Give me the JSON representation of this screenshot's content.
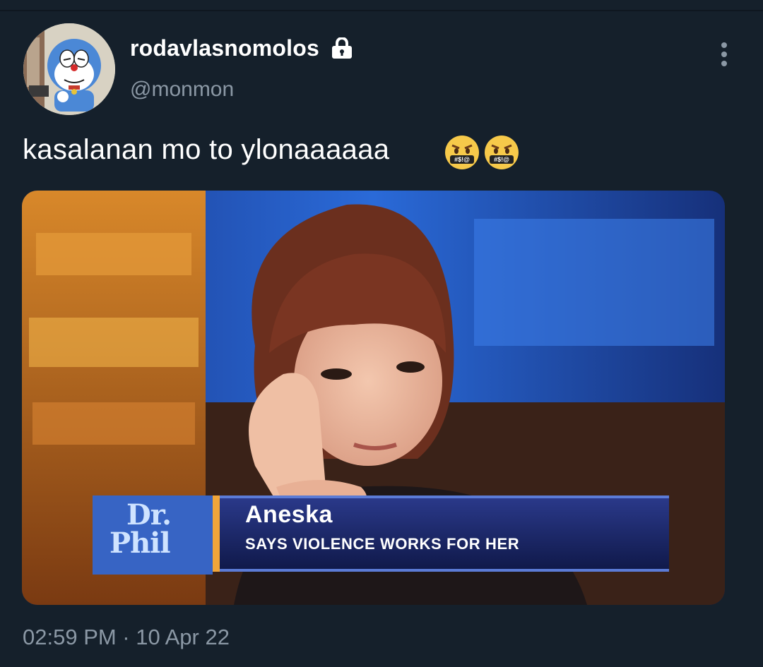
{
  "author": {
    "display_name": "rodavlasnomolos",
    "handle": "@monmon",
    "protected_icon": "lock-icon",
    "avatar_icon": "cartoon-cat-avatar"
  },
  "tweet": {
    "text": "kasalanan mo to ylonaaaaaa",
    "emojis": [
      "face-with-symbols-on-mouth",
      "face-with-symbols-on-mouth"
    ],
    "emoji_glyph": "#$!@"
  },
  "media": {
    "lower_third_name": "Aneska",
    "lower_third_subtitle": "SAYS VIOLENCE WORKS FOR HER",
    "show_logo_line1": "Dr.",
    "show_logo_line2": "Phil"
  },
  "meta": {
    "timestamp": "02:59 PM · 10 Apr 22"
  },
  "menu": {
    "more_icon": "more-vertical-icon"
  },
  "colors": {
    "background": "#15202b",
    "secondary_text": "#8b98a5",
    "primary_text": "#ffffff"
  }
}
